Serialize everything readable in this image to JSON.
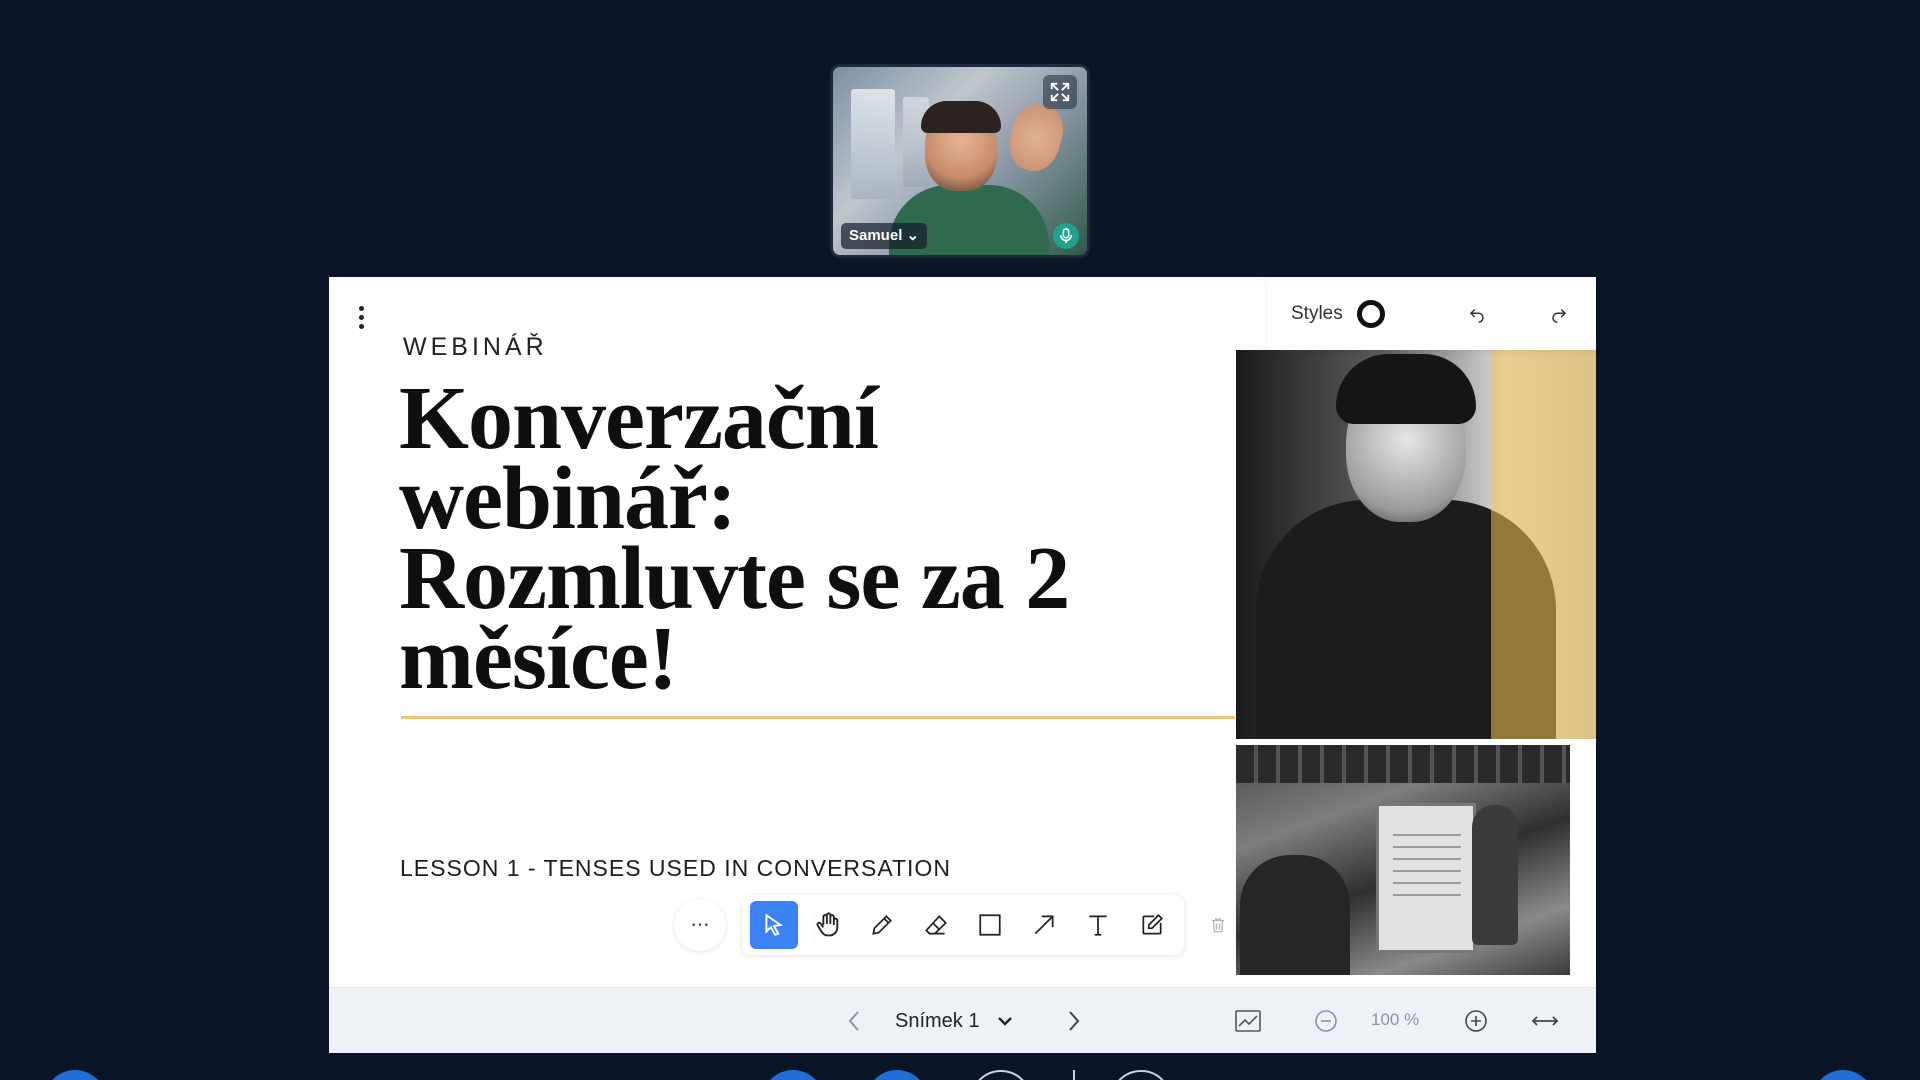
{
  "video": {
    "participant_name": "Samuel",
    "name_chevron": "⌄"
  },
  "slide": {
    "eyebrow": "WEBINÁŘ",
    "headline_lines": [
      "Konverzační",
      "webinář:",
      "Rozmluvte se za 2",
      "měsíce!"
    ],
    "lesson": "LESSON 1 - TENSES USED IN CONVERSATION"
  },
  "styles_panel": {
    "label": "Styles"
  },
  "toolbar": {
    "more_label": "···",
    "tools": [
      "select",
      "hand",
      "pencil",
      "eraser",
      "rectangle",
      "arrow",
      "text",
      "note"
    ],
    "active_tool": "select"
  },
  "nav": {
    "slide_label": "Snímek 1",
    "zoom_level": "100 %"
  },
  "colors": {
    "background": "#0a1628",
    "accent_blue": "#3b82f6",
    "accent_yellow": "#f0c674",
    "mic_green": "#1fa38c"
  }
}
